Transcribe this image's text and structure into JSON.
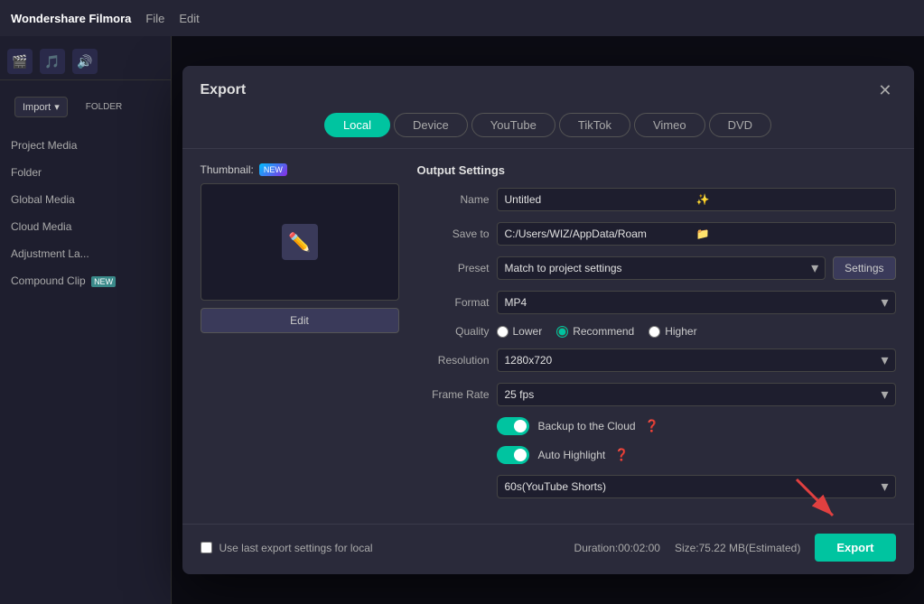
{
  "app": {
    "title": "Filmora",
    "menu": [
      "File",
      "Edit"
    ]
  },
  "sidebar": {
    "items": [
      {
        "label": "Project Media",
        "active": false
      },
      {
        "label": "Folder",
        "badge": "",
        "active": false
      },
      {
        "label": "Global Media",
        "active": false
      },
      {
        "label": "Cloud Media",
        "active": false
      },
      {
        "label": "Adjustment La...",
        "active": false
      },
      {
        "label": "Compound Clip",
        "badge": "NEW",
        "active": false
      }
    ],
    "import_label": "Import"
  },
  "dialog": {
    "title": "Export",
    "close_label": "✕",
    "tabs": [
      {
        "label": "Local",
        "active": true
      },
      {
        "label": "Device",
        "active": false
      },
      {
        "label": "YouTube",
        "active": false
      },
      {
        "label": "TikTok",
        "active": false
      },
      {
        "label": "Vimeo",
        "active": false
      },
      {
        "label": "DVD",
        "active": false
      }
    ],
    "thumbnail": {
      "label": "Thumbnail:",
      "new_badge": "NEW",
      "edit_label": "Edit"
    },
    "output_settings": {
      "title": "Output Settings",
      "fields": {
        "name_label": "Name",
        "name_value": "Untitled",
        "save_to_label": "Save to",
        "save_to_value": "C:/Users/WIZ/AppData/Roam",
        "preset_label": "Preset",
        "preset_value": "Match to project settings",
        "settings_label": "Settings",
        "format_label": "Format",
        "format_value": "MP4",
        "quality_label": "Quality",
        "quality_options": [
          "Lower",
          "Recommend",
          "Higher"
        ],
        "quality_selected": "Recommend",
        "resolution_label": "Resolution",
        "resolution_value": "1280x720",
        "frame_rate_label": "Frame Rate",
        "frame_rate_value": "25 fps"
      },
      "toggles": {
        "backup_label": "Backup to the Cloud",
        "backup_enabled": true,
        "auto_highlight_label": "Auto Highlight",
        "auto_highlight_enabled": true
      },
      "auto_highlight_select": "60s(YouTube Shorts)"
    },
    "footer": {
      "checkbox_label": "Use last export settings for local",
      "duration_label": "Duration:00:02:00",
      "size_label": "Size:75.22 MB(Estimated)",
      "export_label": "Export"
    }
  }
}
